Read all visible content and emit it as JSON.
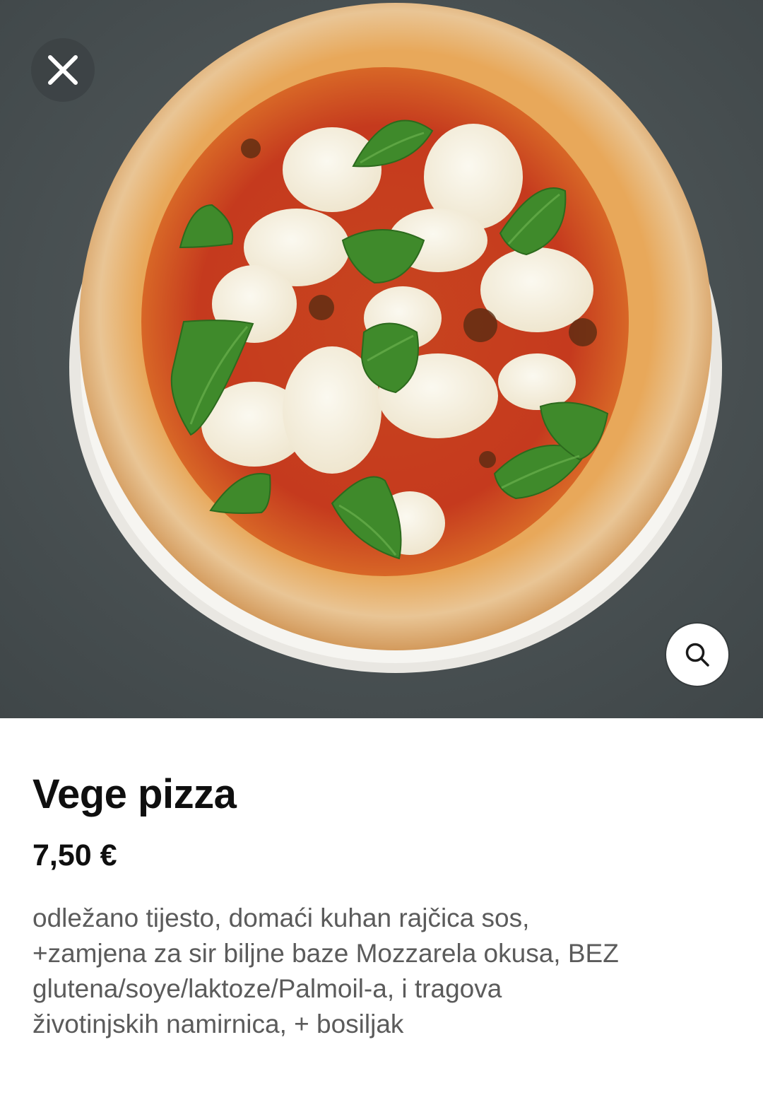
{
  "product": {
    "name": "Vege pizza",
    "price": "7,50 €",
    "description": "odležano tijesto, domaći kuhan rajčica sos,\n+zamjena za sir biljne baze Mozzarela okusa,  BEZ\nglutena/soye/laktoze/Palmoil-a, i tragova\nživotinjskih namirnica, + bosiljak"
  },
  "icons": {
    "close": "close-icon",
    "zoom": "search-icon"
  },
  "colors": {
    "hero_background": "#4b5355",
    "title_text": "#0f0f0f",
    "description_text": "#5b5b5b",
    "close_button_bg": "#3c4244",
    "zoom_button_bg": "#ffffff"
  }
}
